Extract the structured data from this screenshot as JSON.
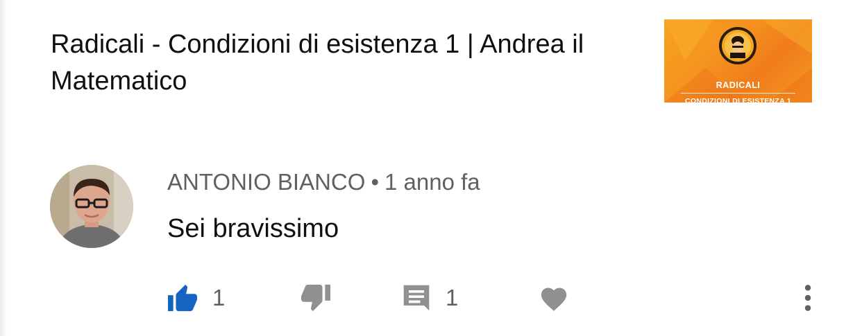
{
  "video": {
    "title": "Radicali - Condizioni di esistenza 1 | Andrea il Matematico",
    "thumbnail": {
      "title": "RADICALI",
      "subtitle": "CONDIZIONI DI ESISTENZA 1",
      "colors": {
        "background": "#f59520",
        "text": "#ffffff"
      }
    }
  },
  "comment": {
    "author": "ANTONIO BIANCO",
    "separator": "•",
    "time": "1 anno fa",
    "text": "Sei bravissimo",
    "like_count": "1",
    "reply_count": "1"
  },
  "actions": {
    "like_icon": "thumb-up-icon",
    "dislike_icon": "thumb-down-icon",
    "reply_icon": "comment-icon",
    "heart_icon": "heart-icon",
    "more_icon": "more-vert-icon",
    "like_color": "#1565c0",
    "icon_color": "#909090"
  }
}
